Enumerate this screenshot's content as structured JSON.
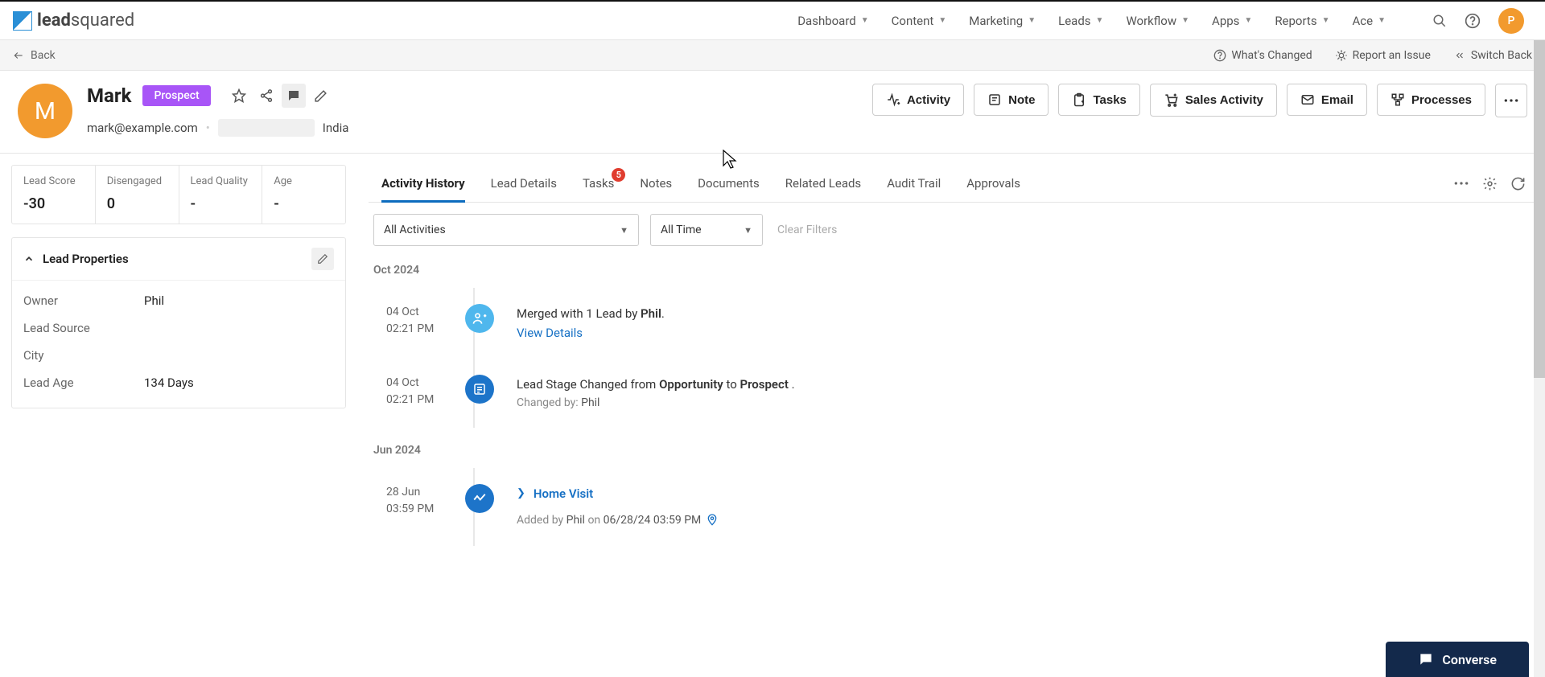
{
  "nav": {
    "items": [
      "Dashboard",
      "Content",
      "Marketing",
      "Leads",
      "Workflow",
      "Apps",
      "Reports",
      "Ace"
    ],
    "user_initial": "P"
  },
  "subbar": {
    "back": "Back",
    "changed": "What's Changed",
    "report": "Report an Issue",
    "switch": "Switch Back"
  },
  "lead": {
    "initial": "M",
    "name": "Mark",
    "stage": "Prospect",
    "email": "mark@example.com",
    "country": "India"
  },
  "actions": {
    "activity": "Activity",
    "note": "Note",
    "tasks": "Tasks",
    "sales": "Sales Activity",
    "email": "Email",
    "processes": "Processes"
  },
  "stats": [
    {
      "label": "Lead Score",
      "value": "-30"
    },
    {
      "label": "Disengaged",
      "value": "0"
    },
    {
      "label": "Lead Quality",
      "value": "-"
    },
    {
      "label": "Age",
      "value": "-"
    }
  ],
  "props": {
    "title": "Lead Properties",
    "rows": [
      {
        "label": "Owner",
        "value": "Phil"
      },
      {
        "label": "Lead Source",
        "value": ""
      },
      {
        "label": "City",
        "value": ""
      },
      {
        "label": "Lead Age",
        "value": "134 Days"
      }
    ]
  },
  "tabs": {
    "items": [
      "Activity History",
      "Lead Details",
      "Tasks",
      "Notes",
      "Documents",
      "Related Leads",
      "Audit Trail",
      "Approvals"
    ],
    "badge_count": "5"
  },
  "filters": {
    "activity": "All Activities",
    "time": "All Time",
    "clear": "Clear Filters"
  },
  "timeline": {
    "m1": "Oct 2024",
    "m2": "Jun 2024",
    "i1": {
      "date": "04 Oct",
      "time": "02:21 PM",
      "text_pre": "Merged with 1 Lead by ",
      "who": "Phil",
      "text_post": ".",
      "link": "View Details"
    },
    "i2": {
      "date": "04 Oct",
      "time": "02:21 PM",
      "pre": "Lead Stage Changed from ",
      "from": "Opportunity",
      "mid": " to ",
      "to": "Prospect",
      "post": " .",
      "sub_pre": "Changed by: ",
      "sub_who": "Phil"
    },
    "i3": {
      "date": "28 Jun",
      "time": "03:59 PM",
      "title": "Home Visit",
      "sub_pre": "Added by ",
      "sub_who": "Phil",
      "sub_mid": " on ",
      "sub_ts": "06/28/24 03:59 PM"
    }
  },
  "converse": "Converse"
}
